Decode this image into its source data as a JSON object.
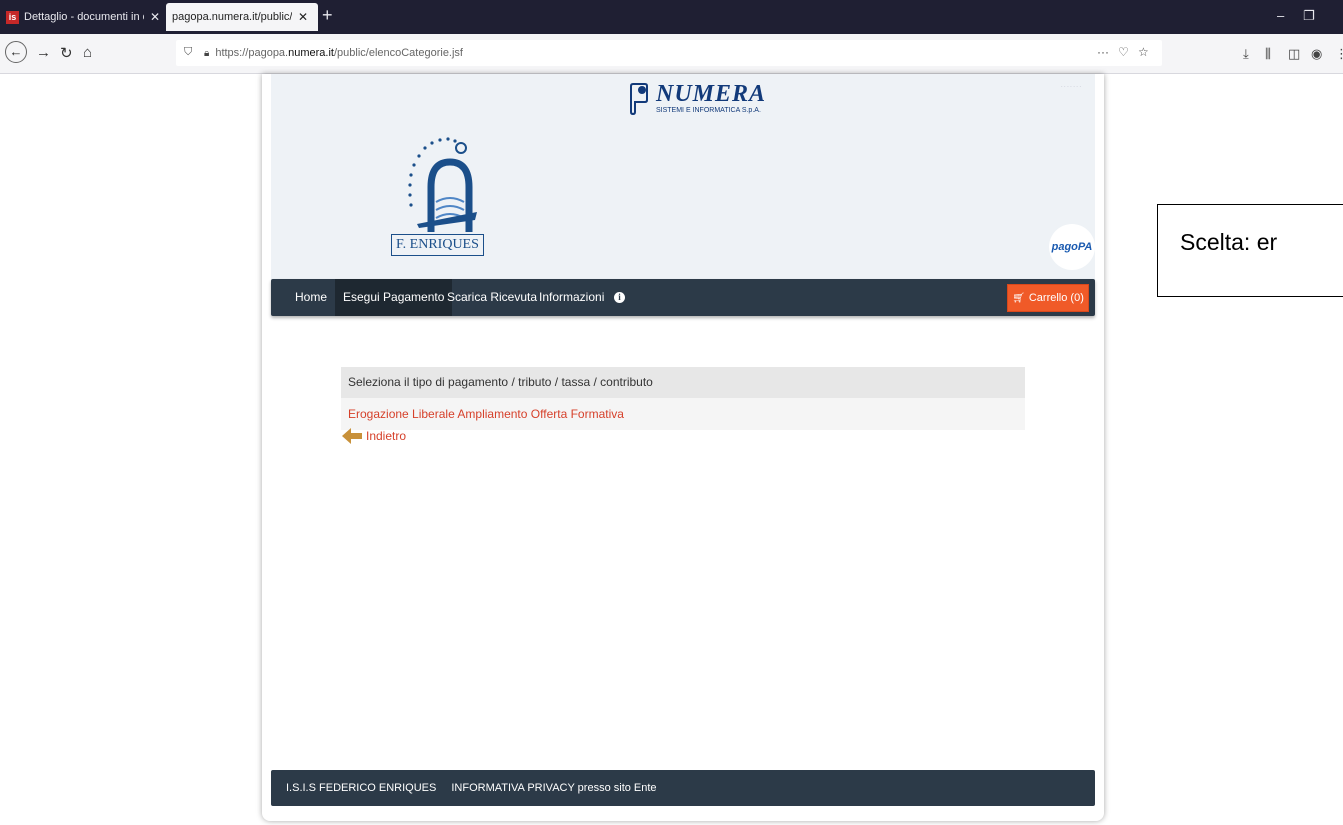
{
  "browser": {
    "tabs": [
      {
        "title": "Dettaglio - documenti in entrat",
        "favicon": "is",
        "active": false
      },
      {
        "title": "pagopa.numera.it/public/elencoCa",
        "active": true
      }
    ],
    "new_tab": "+",
    "url_prefix": "https://pagopa.",
    "url_domain": "numera.it",
    "url_path": "/public/elencoCategorie.jsf",
    "icons": [
      "back-icon",
      "forward-icon",
      "reload-icon",
      "home-icon",
      "shield-icon",
      "lock-icon",
      "more-icon",
      "pocket-icon",
      "star-icon",
      "download-icon",
      "library-icon",
      "sidebar-icon",
      "account-icon",
      "menu-icon",
      "minimize-icon",
      "restore-icon"
    ]
  },
  "header": {
    "numera_name": "NUMERA",
    "numera_sub": "SISTEMI E INFORMATICA S.p.A.",
    "school_label": "F. ENRIQUES",
    "pagopa_label": "pagoPA"
  },
  "menu": {
    "items": [
      {
        "label": "Home",
        "active": false
      },
      {
        "label": "Esegui Pagamento",
        "active": true
      },
      {
        "label": "Scarica Ricevuta",
        "active": false
      },
      {
        "label": "Informazioni",
        "active": false
      }
    ],
    "info_glyph": "i",
    "cart_label": "Carrello (0)"
  },
  "main": {
    "panel_title": "Seleziona il tipo di pagamento / tributo / tassa / contributo",
    "options": [
      "Erogazione Liberale Ampliamento Offerta Formativa"
    ],
    "back_label": "Indietro"
  },
  "footer": {
    "school": "I.S.I.S FEDERICO ENRIQUES",
    "privacy": "INFORMATIVA PRIVACY presso sito Ente"
  },
  "annotation": {
    "text": "Scelta:  er"
  },
  "colors": {
    "tabbar": "#1f1f33",
    "menubar": "#2c3a48",
    "cart": "#f05a28",
    "link": "#d6412b"
  }
}
